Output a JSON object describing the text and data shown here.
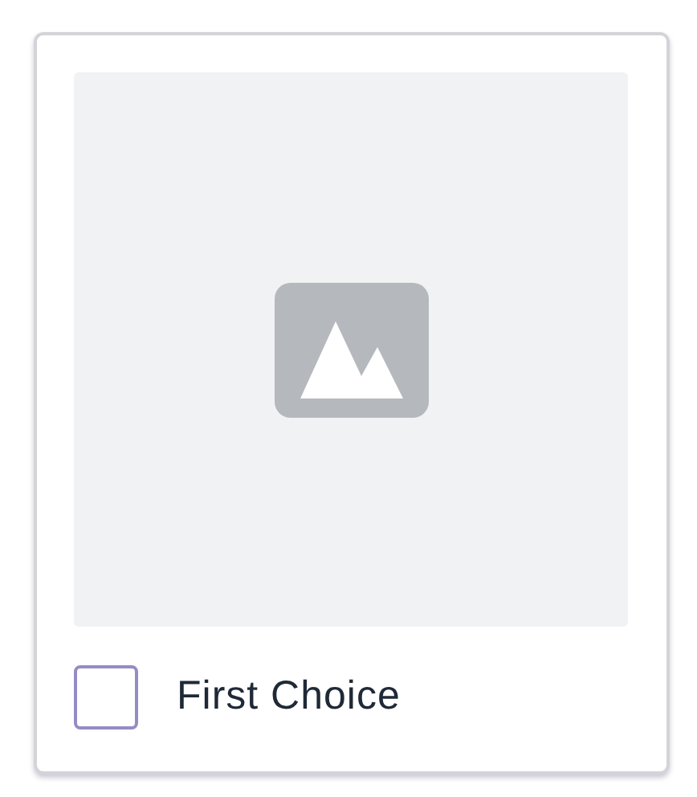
{
  "card": {
    "media": {
      "kind": "placeholder"
    },
    "label": "First Choice",
    "checked": false
  }
}
